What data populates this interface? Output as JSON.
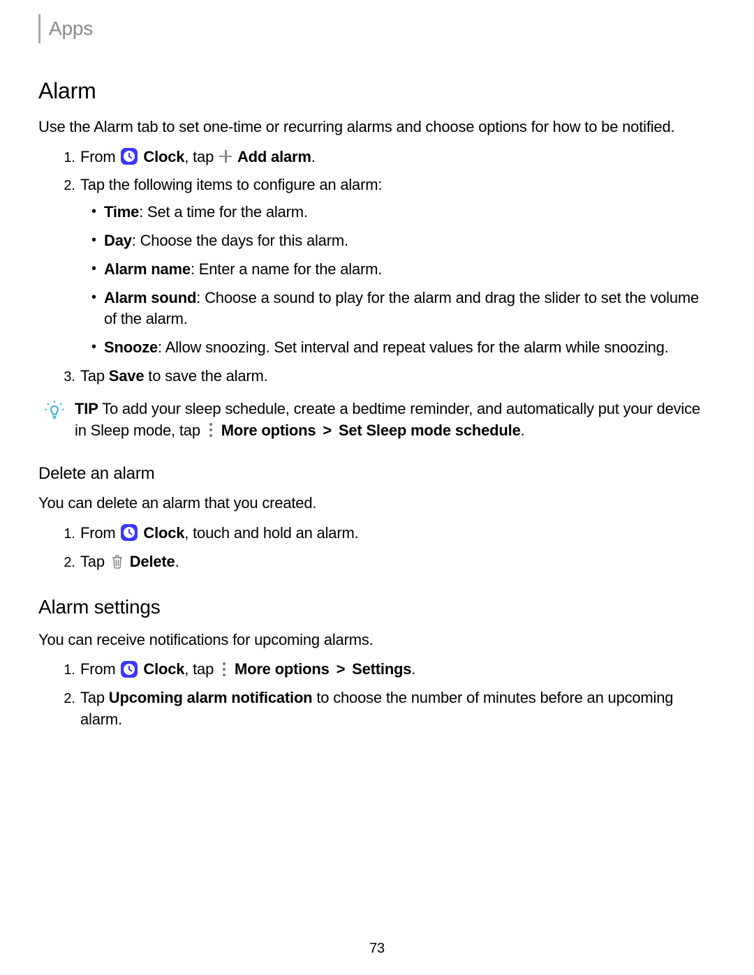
{
  "header": {
    "breadcrumb": "Apps"
  },
  "alarm": {
    "title": "Alarm",
    "intro": "Use the Alarm tab to set one-time or recurring alarms and choose options for how to be notified.",
    "step1_prefix": "From ",
    "clock_label": "Clock",
    "step1_mid": ", tap ",
    "add_alarm_label": "Add alarm",
    "period": ".",
    "step2": "Tap the following items to configure an alarm:",
    "items": {
      "time_label": "Time",
      "time_desc": ": Set a time for the alarm.",
      "day_label": "Day",
      "day_desc": ": Choose the days for this alarm.",
      "name_label": "Alarm name",
      "name_desc": ": Enter a name for the alarm.",
      "sound_label": "Alarm sound",
      "sound_desc": ": Choose a sound to play for the alarm and drag the slider to set the volume of the alarm.",
      "snooze_label": "Snooze",
      "snooze_desc": ": Allow snoozing. Set interval and repeat values for the alarm while snoozing."
    },
    "step3_prefix": "Tap ",
    "save_label": "Save",
    "step3_suffix": " to save the alarm."
  },
  "tip": {
    "label": "TIP",
    "text_a": "  To add your sleep schedule, create a bedtime reminder, and automatically put your device in Sleep mode, tap ",
    "more_label": "More options",
    "gt": " > ",
    "set_sleep_label": "Set Sleep mode schedule",
    "period": "."
  },
  "delete": {
    "title": "Delete an alarm",
    "intro": "You can delete an alarm that you created.",
    "step1_prefix": "From ",
    "clock_label": "Clock",
    "step1_suffix": ", touch and hold an alarm.",
    "step2_prefix": "Tap ",
    "delete_label": "Delete",
    "period": "."
  },
  "settings": {
    "title": "Alarm settings",
    "intro": "You can receive notifications for upcoming alarms.",
    "step1_prefix": "From ",
    "clock_label": "Clock",
    "step1_mid": ", tap ",
    "more_label": "More options",
    "gt": " > ",
    "settings_label": "Settings",
    "period": ".",
    "step2_prefix": "Tap ",
    "upcoming_label": "Upcoming alarm notification",
    "step2_suffix": " to choose the number of minutes before an upcoming alarm."
  },
  "page_number": "73"
}
